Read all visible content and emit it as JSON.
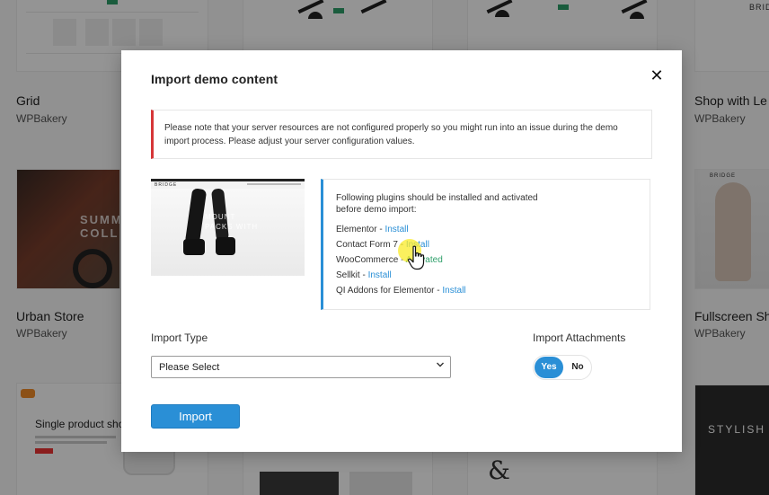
{
  "background": {
    "cards": [
      {
        "title": "Grid",
        "subtitle": "WPBakery"
      },
      {
        "title": "Shop with Le",
        "subtitle": "WPBakery"
      },
      {
        "title": "Urban Store",
        "subtitle": "WPBakery"
      },
      {
        "title": "Fullscreen Sh",
        "subtitle": "WPBakery"
      }
    ],
    "thumb_texts": {
      "urban": "SUMM\nCOLLE",
      "single_product": "Single product shop",
      "stylish": "STYLISH",
      "shop_brand": "BRIDG",
      "fullscreen_brand": "BRIDGE"
    }
  },
  "modal": {
    "title": "Import demo content",
    "notice": "Please note that your server resources are not configured properly so you might run into an issue during the demo import process. Please adjust your server configuration values.",
    "preview": {
      "brand": "BRIDGE",
      "text": "MOUNT\nPACKS WITH"
    },
    "plugins": {
      "intro_line1": "Following plugins should be installed and activated",
      "intro_line2": "before demo import:",
      "items": [
        {
          "name": "Elementor",
          "action": "Install"
        },
        {
          "name": "Contact Form 7",
          "action": "Install"
        },
        {
          "name": "WooCommerce",
          "action": "Activated"
        },
        {
          "name": "Sellkit",
          "action": "Install"
        },
        {
          "name": "QI Addons for Elementor",
          "action": "Install"
        }
      ]
    },
    "import_type": {
      "label": "Import Type",
      "value": "Please Select"
    },
    "import_attachments": {
      "label": "Import Attachments",
      "yes": "Yes",
      "no": "No",
      "selected": "Yes"
    },
    "import_button": "Import"
  },
  "colors": {
    "accent": "#2a8fd6",
    "warning": "#d63638",
    "activated": "#2e9f6a"
  }
}
